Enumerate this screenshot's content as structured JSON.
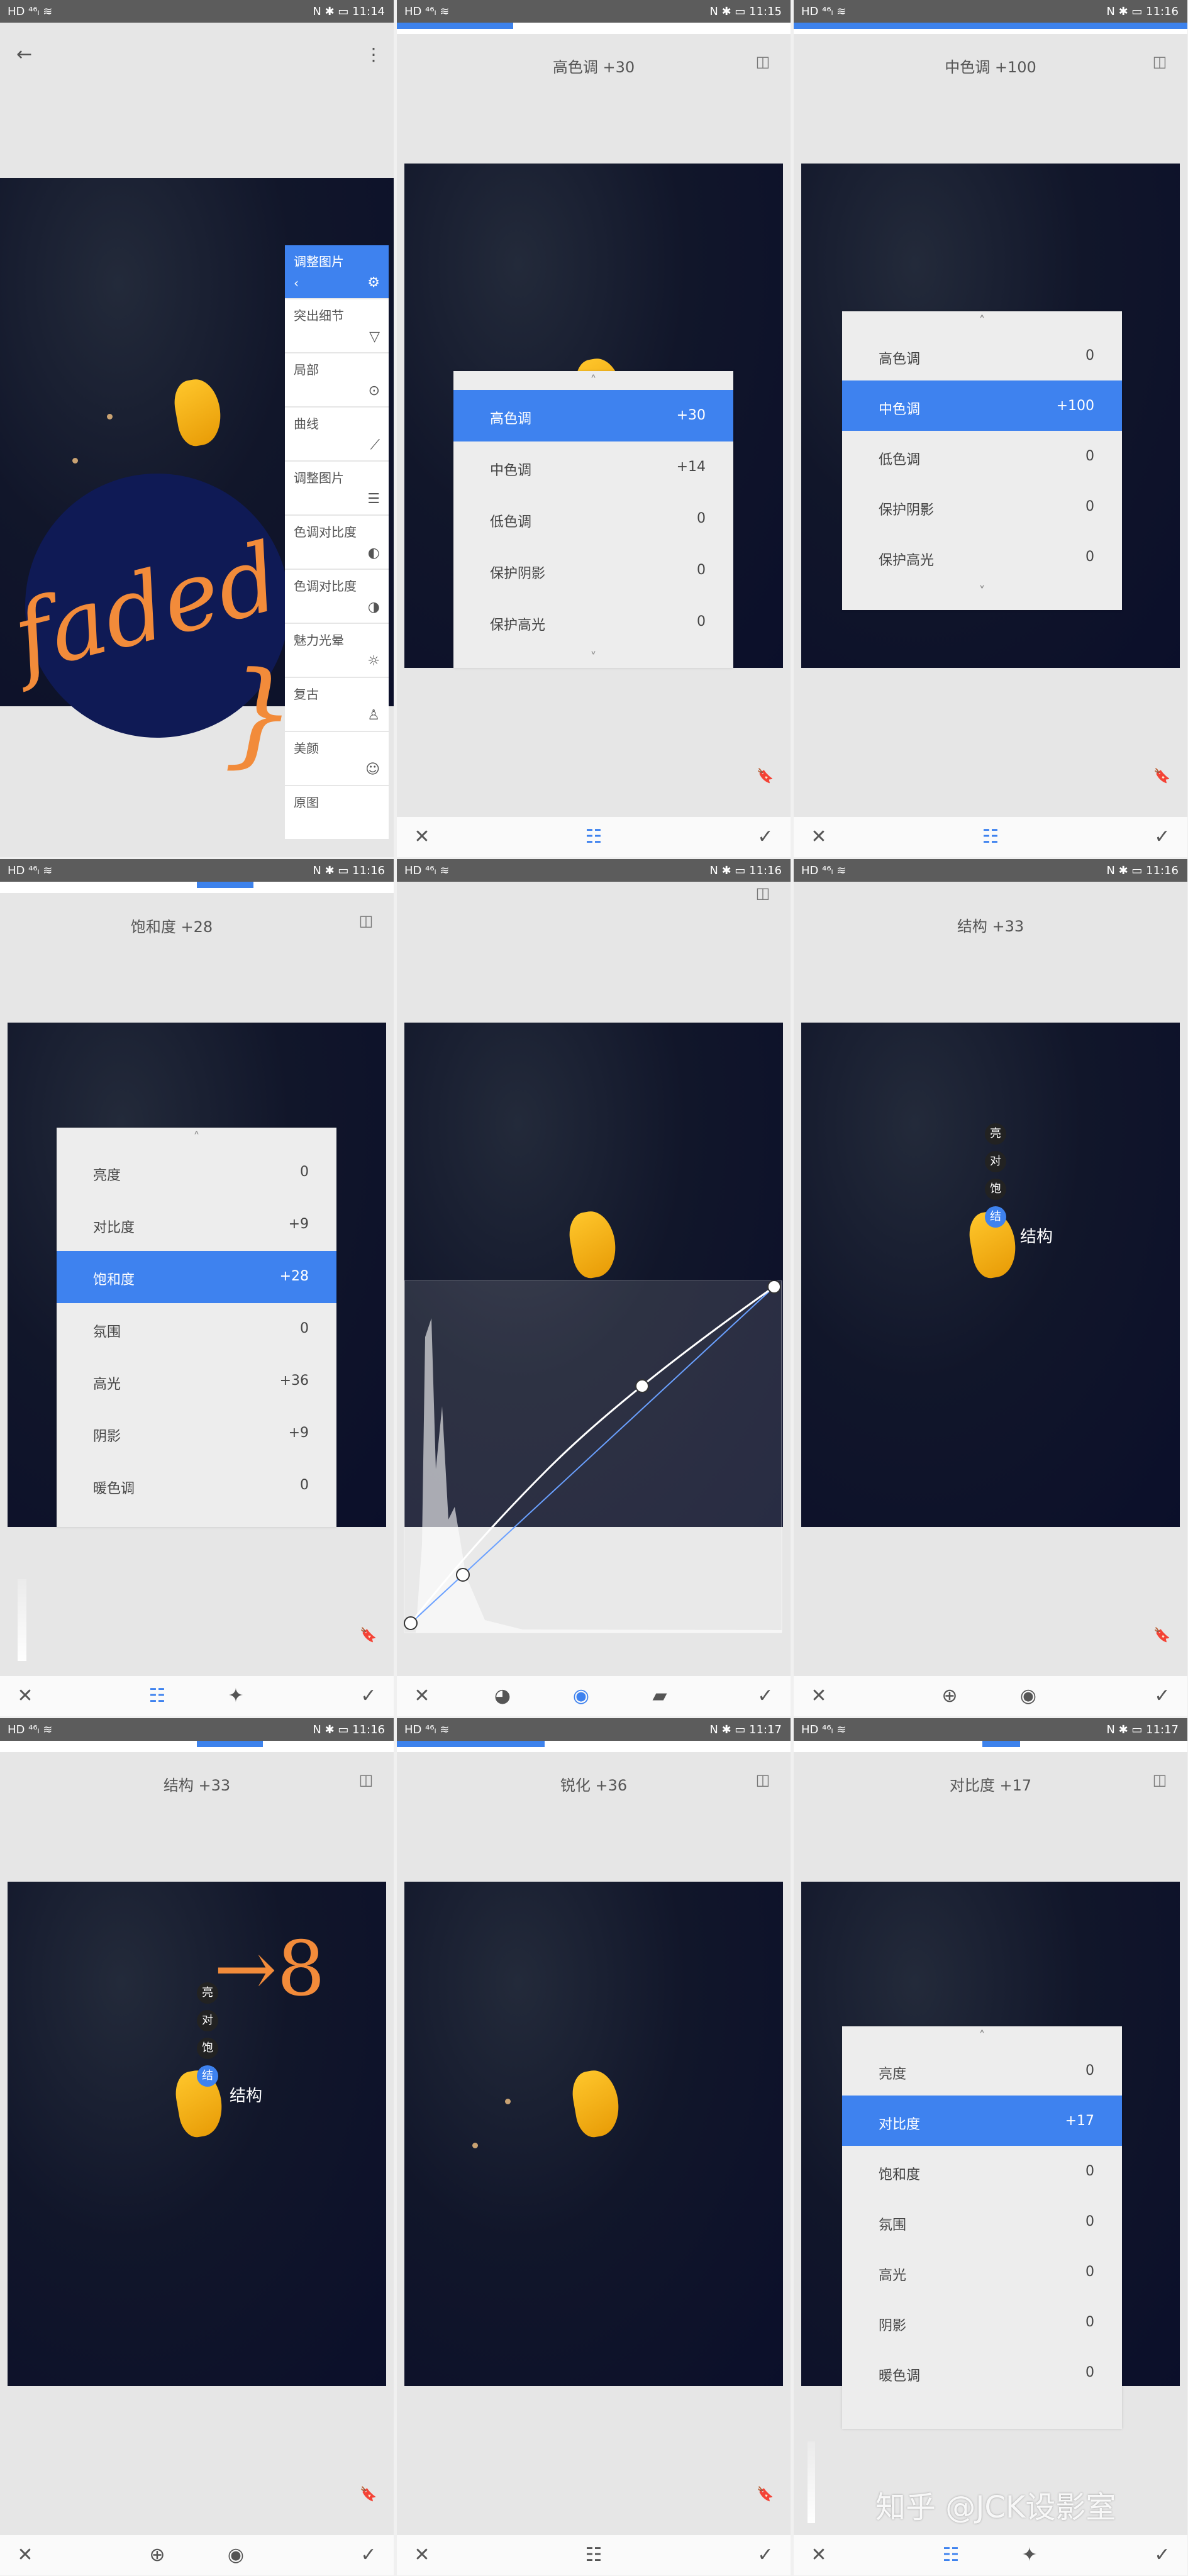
{
  "status": {
    "left": "HD ⁴⁶ₗ ≋",
    "right_time": [
      "11:14",
      "11:15",
      "11:16",
      "11:16",
      "11:16",
      "11:16",
      "11:16",
      "11:17",
      "11:17"
    ],
    "right_icons": "N ✱ ▭"
  },
  "p1": {
    "tools": [
      {
        "label": "调整图片",
        "icon": "⚙"
      },
      {
        "label": "突出细节",
        "icon": "▽"
      },
      {
        "label": "局部",
        "icon": "⊙"
      },
      {
        "label": "曲线",
        "icon": "⟋"
      },
      {
        "label": "调整图片",
        "icon": "☰"
      },
      {
        "label": "色调对比度",
        "icon": "◐"
      },
      {
        "label": "色调对比度",
        "icon": "◑"
      },
      {
        "label": "魅力光晕",
        "icon": "☼"
      },
      {
        "label": "复古",
        "icon": "♙"
      },
      {
        "label": "美颜",
        "icon": "☺"
      },
      {
        "label": "原图",
        "icon": ""
      }
    ],
    "tools_back": "‹",
    "annotation_faded": "faded",
    "annotation_brace": "}"
  },
  "p2": {
    "title": "高色调 +30",
    "rows": [
      {
        "label": "高色调",
        "value": "+30"
      },
      {
        "label": "中色调",
        "value": "+14"
      },
      {
        "label": "低色调",
        "value": "0"
      },
      {
        "label": "保护阴影",
        "value": "0"
      },
      {
        "label": "保护高光",
        "value": "0"
      }
    ]
  },
  "p3": {
    "title": "中色调 +100",
    "rows": [
      {
        "label": "高色调",
        "value": "0"
      },
      {
        "label": "中色调",
        "value": "+100"
      },
      {
        "label": "低色调",
        "value": "0"
      },
      {
        "label": "保护阴影",
        "value": "0"
      },
      {
        "label": "保护高光",
        "value": "0"
      }
    ]
  },
  "p4": {
    "title": "饱和度 +28",
    "rows": [
      {
        "label": "亮度",
        "value": "0"
      },
      {
        "label": "对比度",
        "value": "+9"
      },
      {
        "label": "饱和度",
        "value": "+28"
      },
      {
        "label": "氛围",
        "value": "0"
      },
      {
        "label": "高光",
        "value": "+36"
      },
      {
        "label": "阴影",
        "value": "+9"
      },
      {
        "label": "暖色调",
        "value": "0"
      }
    ]
  },
  "p6": {
    "title": "结构 +33",
    "pins": [
      "亮",
      "对",
      "饱",
      "结"
    ],
    "pin_label": "结构"
  },
  "p7": {
    "title": "结构 +33",
    "pins": [
      "亮",
      "对",
      "饱",
      "结"
    ],
    "pin_label": "结构",
    "annotation": "→8"
  },
  "p8": {
    "title": "锐化 +36"
  },
  "p9": {
    "title": "对比度 +17",
    "rows": [
      {
        "label": "亮度",
        "value": "0"
      },
      {
        "label": "对比度",
        "value": "+17"
      },
      {
        "label": "饱和度",
        "value": "0"
      },
      {
        "label": "氛围",
        "value": "0"
      },
      {
        "label": "高光",
        "value": "0"
      },
      {
        "label": "阴影",
        "value": "0"
      },
      {
        "label": "暖色调",
        "value": "0"
      }
    ]
  },
  "watermark": "知乎 @JCK设影室",
  "colors": {
    "accent": "#3e82ef",
    "annotation": "#f28b3a"
  }
}
